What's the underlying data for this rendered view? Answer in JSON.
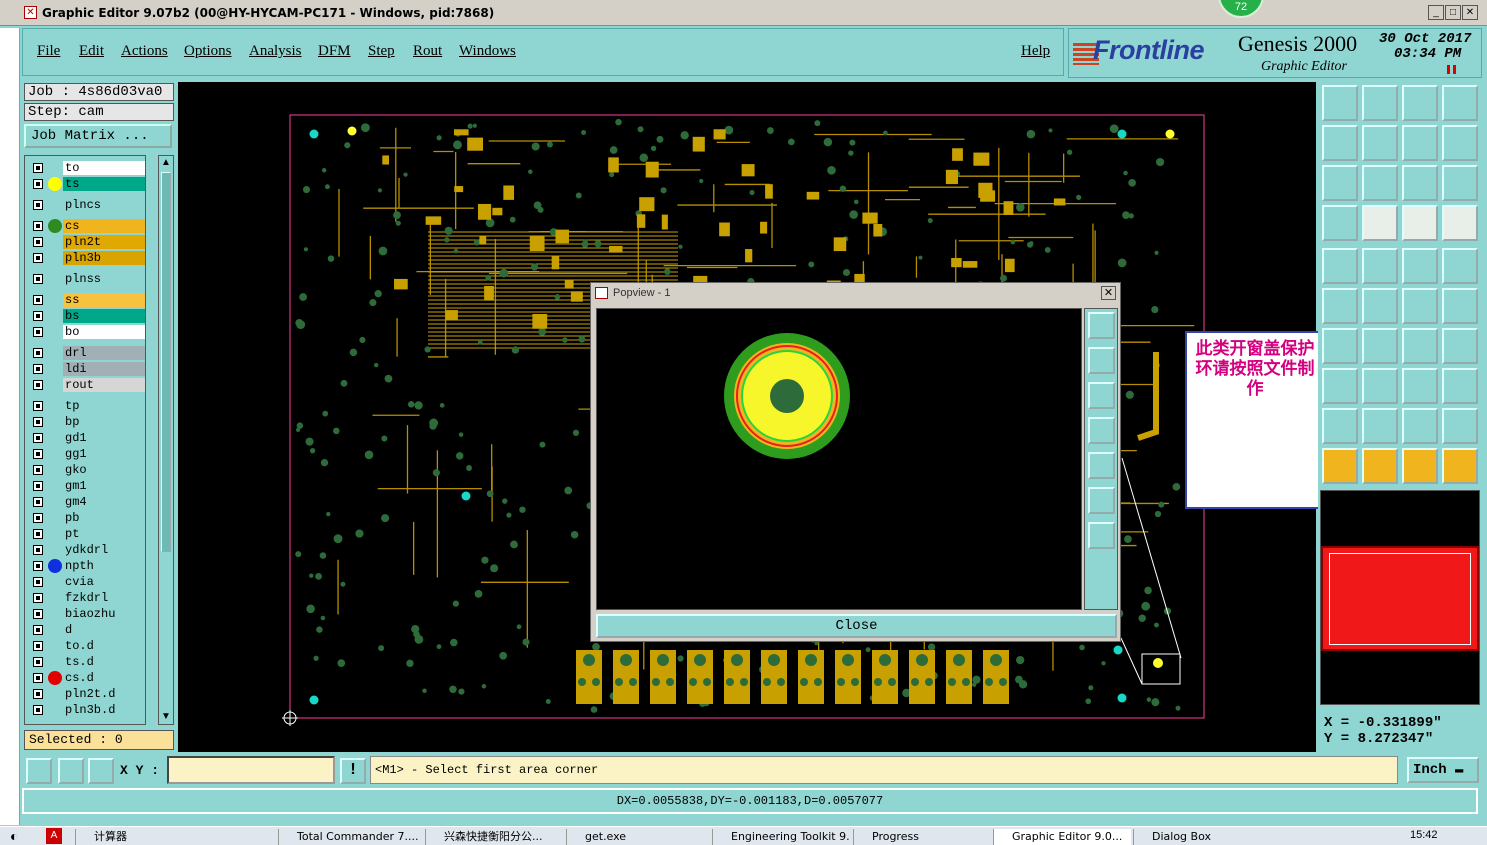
{
  "window": {
    "title": "Graphic Editor 9.07b2 (00@HY-HYCAM-PC171 - Windows, pid:7868)",
    "badge": "72"
  },
  "menu": {
    "file": "File",
    "edit": "Edit",
    "actions": "Actions",
    "options": "Options",
    "analysis": "Analysis",
    "dfm": "DFM",
    "step": "Step",
    "rout": "Rout",
    "windows": "Windows",
    "help": "Help"
  },
  "brand": {
    "logo": "Frontline",
    "product": "Genesis 2000",
    "subtitle": "Graphic Editor",
    "date": "30 Oct 2017",
    "time": "03:34 PM"
  },
  "job": {
    "job_line": "Job : 4s86d03va0",
    "step_line": "Step: cam",
    "matrix_button": "Job Matrix ..."
  },
  "layers": [
    {
      "name": "to",
      "color": "#ffffff",
      "dot": ""
    },
    {
      "name": "ts",
      "color": "#00a88a",
      "dot": "#ffff00"
    },
    {
      "name": "plncs",
      "color": "#8fd6d2",
      "dot": ""
    },
    {
      "name": "cs",
      "color": "#f0b41e",
      "dot": "#2e8b22"
    },
    {
      "name": "pln2t",
      "color": "#e0a800",
      "dot": ""
    },
    {
      "name": "pln3b",
      "color": "#d9a400",
      "dot": ""
    },
    {
      "name": "plnss",
      "color": "#8fd6d2",
      "dot": ""
    },
    {
      "name": "ss",
      "color": "#f7c23e",
      "dot": ""
    },
    {
      "name": "bs",
      "color": "#00a88a",
      "dot": ""
    },
    {
      "name": "bo",
      "color": "#ffffff",
      "dot": ""
    },
    {
      "name": "drl",
      "color": "#a0b0b4",
      "dot": ""
    },
    {
      "name": "ldi",
      "color": "#a0b0b4",
      "dot": ""
    },
    {
      "name": "rout",
      "color": "#d6d6d6",
      "dot": ""
    },
    {
      "name": "tp",
      "color": "#8fd6d2",
      "dot": ""
    },
    {
      "name": "bp",
      "color": "#8fd6d2",
      "dot": ""
    },
    {
      "name": "gd1",
      "color": "#8fd6d2",
      "dot": ""
    },
    {
      "name": "gg1",
      "color": "#8fd6d2",
      "dot": ""
    },
    {
      "name": "gko",
      "color": "#8fd6d2",
      "dot": ""
    },
    {
      "name": "gm1",
      "color": "#8fd6d2",
      "dot": ""
    },
    {
      "name": "gm4",
      "color": "#8fd6d2",
      "dot": ""
    },
    {
      "name": "pb",
      "color": "#8fd6d2",
      "dot": ""
    },
    {
      "name": "pt",
      "color": "#8fd6d2",
      "dot": ""
    },
    {
      "name": "ydkdrl",
      "color": "#8fd6d2",
      "dot": ""
    },
    {
      "name": "npth",
      "color": "#8fd6d2",
      "dot": "#1030e0"
    },
    {
      "name": "cvia",
      "color": "#8fd6d2",
      "dot": ""
    },
    {
      "name": "fzkdrl",
      "color": "#8fd6d2",
      "dot": ""
    },
    {
      "name": "biaozhu",
      "color": "#8fd6d2",
      "dot": ""
    },
    {
      "name": "d",
      "color": "#8fd6d2",
      "dot": ""
    },
    {
      "name": "to.d",
      "color": "#8fd6d2",
      "dot": ""
    },
    {
      "name": "ts.d",
      "color": "#8fd6d2",
      "dot": ""
    },
    {
      "name": "cs.d",
      "color": "#8fd6d2",
      "dot": "#e00000"
    },
    {
      "name": "pln2t.d",
      "color": "#8fd6d2",
      "dot": ""
    },
    {
      "name": "pln3b.d",
      "color": "#8fd6d2",
      "dot": ""
    }
  ],
  "selected": "Selected : 0",
  "popup": {
    "title": "Popview - 1",
    "close_label": "Close"
  },
  "note": {
    "text": "此类开窗盖保护环请按照文件制作"
  },
  "coords": {
    "x": "X = -0.331899\"",
    "y": "Y = 8.272347\""
  },
  "bottom": {
    "xy_label": "X Y :",
    "xy_value": "",
    "prompt": "<M1> - Select first area corner",
    "units": "Inch"
  },
  "status": {
    "text": "DX=0.0055838,DY=-0.001183,D=0.0057077"
  },
  "taskbar": {
    "items": [
      "计算器",
      "Total Commander 7....",
      "兴森快捷衡阳分公...",
      "get.exe",
      "Engineering Toolkit 9....",
      "Progress",
      "Graphic Editor 9.0...",
      "Dialog Box"
    ],
    "clock": "15:42"
  },
  "colors": {
    "panel": "#8fd6d2",
    "accent_brand": "#2b3fa0",
    "note_text": "#d4007f",
    "pcb_trace": "#c8a000",
    "pcb_pad": "#2e6b3a"
  }
}
